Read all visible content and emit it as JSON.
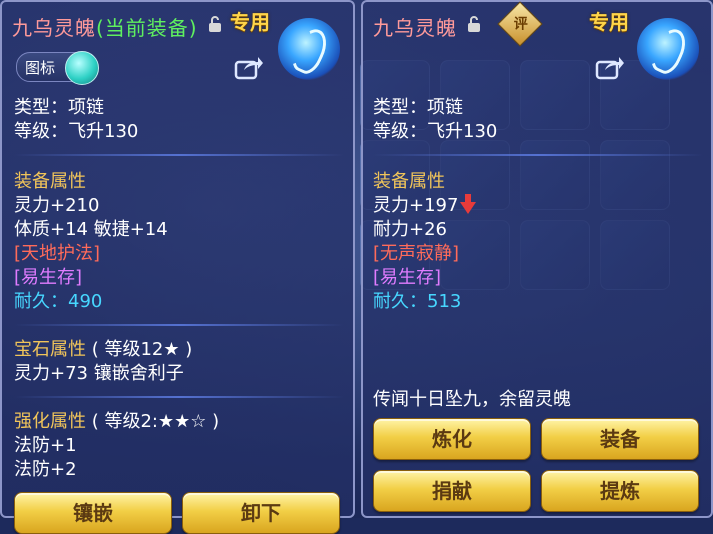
{
  "left_panel": {
    "item_name": "九乌灵魄",
    "equipped_tag": "(当前装备)",
    "special_label": "专用",
    "icon_toggle_label": "图标",
    "type_line": "类型：项链",
    "level_line": "等级：飞升130",
    "equip_attr_header": "装备属性",
    "stat_spirit": "灵力+210",
    "stat_con_agi": "体质+14 敏捷+14",
    "effect_1": "[天地护法]",
    "effect_2": "[易生存]",
    "durability": "耐久：490",
    "gem_header": "宝石属性",
    "gem_level": "( 等级12★ )",
    "gem_line": "灵力+73 镶嵌舍利子",
    "enhance_header": "强化属性",
    "enhance_level": "( 等级2:★★☆ )",
    "enhance_1": "法防+1",
    "enhance_2": "法防+2",
    "btn_inlay": "镶嵌",
    "btn_unequip": "卸下"
  },
  "right_panel": {
    "item_name": "九乌灵魄",
    "rating_label": "评",
    "special_label": "专用",
    "type_line": "类型：项链",
    "level_line": "等级：飞升130",
    "equip_attr_header": "装备属性",
    "stat_spirit": "灵力+197",
    "stat_endurance": "耐力+26",
    "effect_1": "[无声寂静]",
    "effect_2": "[易生存]",
    "durability": "耐久：513",
    "flavor_text": "传闻十日坠九，余留灵魄",
    "btn_refine": "炼化",
    "btn_equip": "装备",
    "btn_donate": "捐献",
    "btn_extract": "提炼"
  },
  "colors": {
    "panel_border": "#8d96c9",
    "title": "#ff9a9a",
    "equipped": "#5ff05f",
    "header_gold": "#f0c45a",
    "effect_red": "#ff6b5a",
    "effect_purple": "#e07cff",
    "durability_cyan": "#47d7ff",
    "button_gold": "#f2cf46"
  }
}
